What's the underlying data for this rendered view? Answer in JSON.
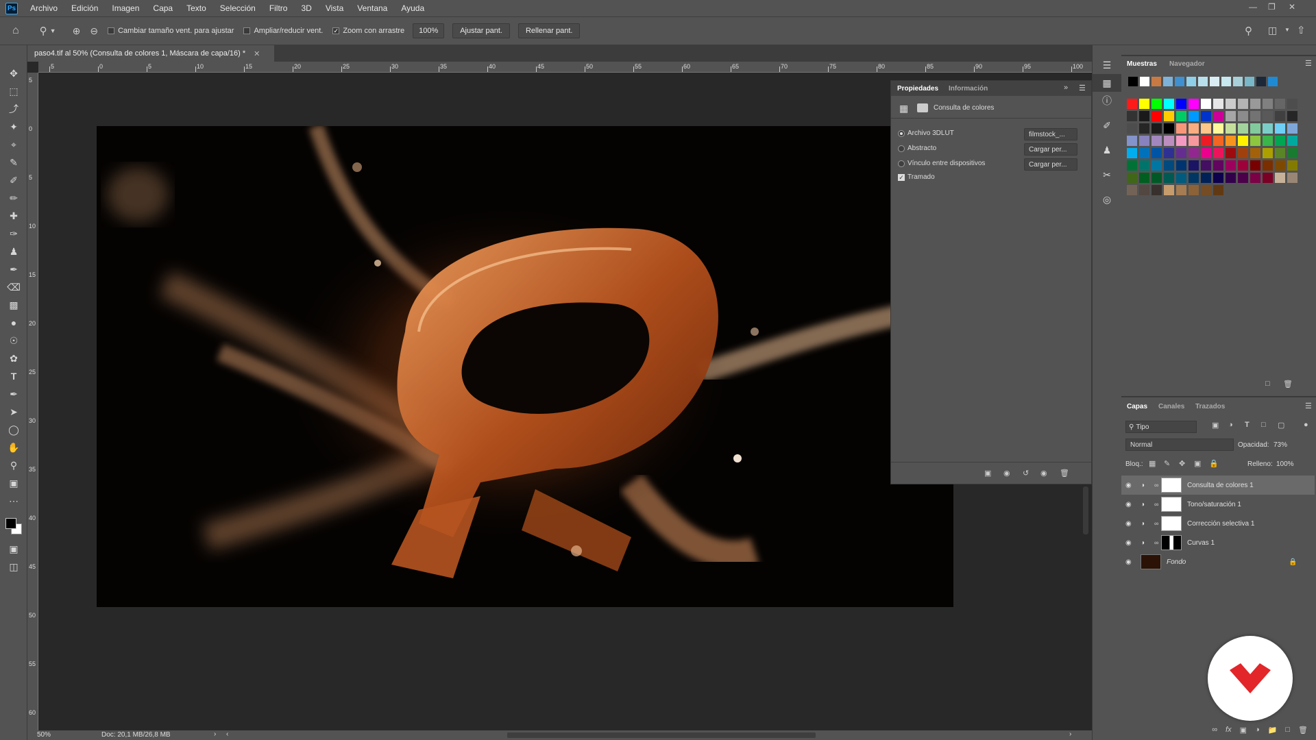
{
  "menubar": {
    "logo": "Ps",
    "items": [
      "Archivo",
      "Edición",
      "Imagen",
      "Capa",
      "Texto",
      "Selección",
      "Filtro",
      "3D",
      "Vista",
      "Ventana",
      "Ayuda"
    ]
  },
  "options": {
    "resize_windows": "Cambiar tamaño vent. para ajustar",
    "zoom_all": "Ampliar/reducir vent.",
    "scrubby": "Zoom con arrastre",
    "zoom_value": "100%",
    "fit_screen": "Ajustar pant.",
    "fill_screen": "Rellenar pant."
  },
  "document": {
    "tab_title": "paso4.tif al 50% (Consulta de colores 1, Máscara de capa/16) *",
    "zoom": "50%",
    "doc_info": "Doc: 20,1 MB/26,8 MB"
  },
  "ruler": {
    "h_labels": [
      "5",
      "0",
      "5",
      "10",
      "15",
      "20",
      "25",
      "30",
      "35",
      "40",
      "45",
      "50",
      "55",
      "60",
      "65",
      "70",
      "75",
      "80",
      "85",
      "90",
      "95",
      "100"
    ],
    "v_labels": [
      "5",
      "0",
      "5",
      "10",
      "15",
      "20",
      "25",
      "30",
      "35",
      "40",
      "45",
      "50",
      "55",
      "60"
    ]
  },
  "properties": {
    "tab_active": "Propiedades",
    "tab_info": "Información",
    "header": "Consulta de colores",
    "options": [
      {
        "label": "Archivo 3DLUT",
        "value": "filmstock_..."
      },
      {
        "label": "Abstracto",
        "value": "Cargar per..."
      },
      {
        "label": "Vínculo entre dispositivos",
        "value": "Cargar per..."
      }
    ],
    "dither": "Tramado"
  },
  "swatches": {
    "tab_active": "Muestras",
    "tab_nav": "Navegador",
    "recent": [
      "#000000",
      "#ffffff",
      "#c87a45",
      "#7fb2d8",
      "#3f90d0",
      "#8fcfe8",
      "#b8e0ec",
      "#d8eef4",
      "#c6e8ee",
      "#a8d0d8",
      "#78b8c8",
      "#1c2838",
      "#1f8ad4"
    ],
    "rows": [
      [
        "#ff1a1a",
        "#ffff00",
        "#00ff00",
        "#00ffff",
        "#0000ff",
        "#ff00ff",
        "#ffffff",
        "#e6e6e6",
        "#cccccc",
        "#b3b3b3",
        "#999999",
        "#808080",
        "#666666",
        "#4d4d4d"
      ],
      [
        "#333333",
        "#1a1a1a",
        "#ff0000",
        "#ffcc00",
        "#00cc66",
        "#0099ff",
        "#0033cc",
        "#cc0099",
        "#a6a6a6",
        "#8c8c8c",
        "#737373",
        "#595959",
        "#404040",
        "#262626"
      ],
      [
        "#4d4d4d",
        "#262626",
        "#1a1a1a",
        "#000000",
        "#f7977a",
        "#f9ad81",
        "#fdc68a",
        "#fff79a",
        "#c4df9b",
        "#a3d39c",
        "#82ca9d",
        "#7bcdc8",
        "#6ecff6",
        "#7ea7d8"
      ],
      [
        "#8493ca",
        "#8882be",
        "#a187be",
        "#bc8dbf",
        "#f49ac2",
        "#f6989d",
        "#ed1c24",
        "#f26522",
        "#f7941d",
        "#fff200",
        "#8dc73f",
        "#39b54a",
        "#00a651",
        "#00a99d"
      ],
      [
        "#00aeef",
        "#0072bc",
        "#0054a6",
        "#2e3192",
        "#662d91",
        "#92278f",
        "#ec008c",
        "#ed145b",
        "#9e0b0f",
        "#a0410d",
        "#a3620a",
        "#aba000",
        "#598527",
        "#197b30"
      ],
      [
        "#007236",
        "#00746b",
        "#0076a3",
        "#004a80",
        "#003471",
        "#1b1464",
        "#440e62",
        "#630460",
        "#9e005d",
        "#9e0039",
        "#790000",
        "#7b2e00",
        "#7d4900",
        "#827b00"
      ],
      [
        "#406618",
        "#005e20",
        "#005826",
        "#005952",
        "#005b7f",
        "#003663",
        "#002157",
        "#0d004c",
        "#32004b",
        "#4b0049",
        "#7b0046",
        "#7a0026",
        "#c7b299",
        "#998675"
      ],
      [
        "#736357",
        "#534741",
        "#37302d",
        "#c69c6d",
        "#a67c52",
        "#8c6239",
        "#754c24",
        "#603913"
      ]
    ]
  },
  "layers": {
    "tabs": [
      "Capas",
      "Canales",
      "Trazados"
    ],
    "filter": "Tipo",
    "blend_mode": "Normal",
    "opacity_label": "Opacidad:",
    "opacity": "73%",
    "lock_label": "Bloq.:",
    "fill_label": "Relleno:",
    "fill": "100%",
    "items": [
      {
        "name": "Consulta de colores 1",
        "selected": true
      },
      {
        "name": "Tono/saturación 1",
        "selected": false
      },
      {
        "name": "Corrección selectiva 1",
        "selected": false
      },
      {
        "name": "Curvas 1",
        "selected": false
      },
      {
        "name": "Fondo",
        "selected": false
      }
    ]
  },
  "colors": {
    "accent": "#31a8ff",
    "brand_red": "#e2262a",
    "panel": "#535353"
  }
}
